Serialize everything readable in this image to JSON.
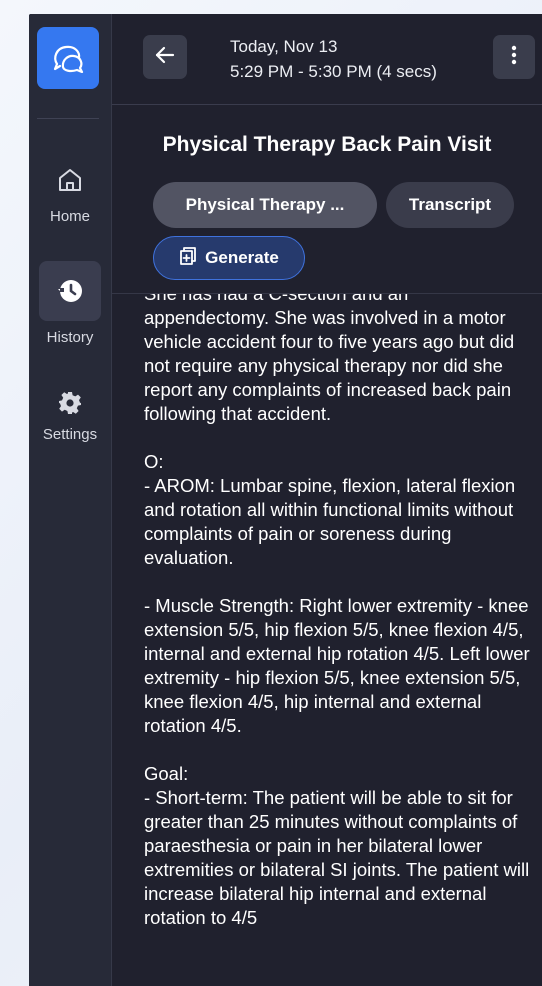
{
  "sidebar": {
    "logo_icon": "chat-logo-icon",
    "items": [
      {
        "label": "Home",
        "icon": "home-icon"
      },
      {
        "label": "History",
        "icon": "history-icon",
        "active": true
      },
      {
        "label": "Settings",
        "icon": "gear-icon"
      }
    ]
  },
  "header": {
    "back_icon": "arrow-left-icon",
    "date": "Today, Nov 13",
    "time_range": "5:29 PM - 5:30 PM (4 secs)",
    "menu_icon": "vertical-dots-icon"
  },
  "visit": {
    "title": "Physical Therapy Back Pain Visit",
    "tabs": [
      "Physical Therapy ...",
      "Transcript"
    ],
    "generate_label": "Generate"
  },
  "note": {
    "paragraphs": [
      "She has had a C-section and an appendectomy. She was involved in a motor vehicle accident four to five years ago but did not require any physical therapy nor did she report any complaints of increased back pain following that accident.",
      "O:\n- AROM: Lumbar spine, flexion, lateral flexion and rotation all within functional limits without complaints of pain or soreness during evaluation.",
      "- Muscle Strength: Right lower extremity - knee extension 5/5, hip flexion 5/5, knee flexion 4/5, internal and external hip rotation 4/5. Left lower extremity - hip flexion 5/5, knee extension 5/5, knee flexion 4/5, hip internal and external rotation 4/5.",
      "Goal:\n- Short-term: The patient will be able to sit for greater than 25 minutes without complaints of paraesthesia or pain in her bilateral lower extremities or bilateral SI joints. The patient will increase bilateral hip internal and external rotation to 4/5"
    ]
  },
  "colors": {
    "accent": "#3578f0",
    "background": "#20212e",
    "sidebar": "#272a38"
  }
}
